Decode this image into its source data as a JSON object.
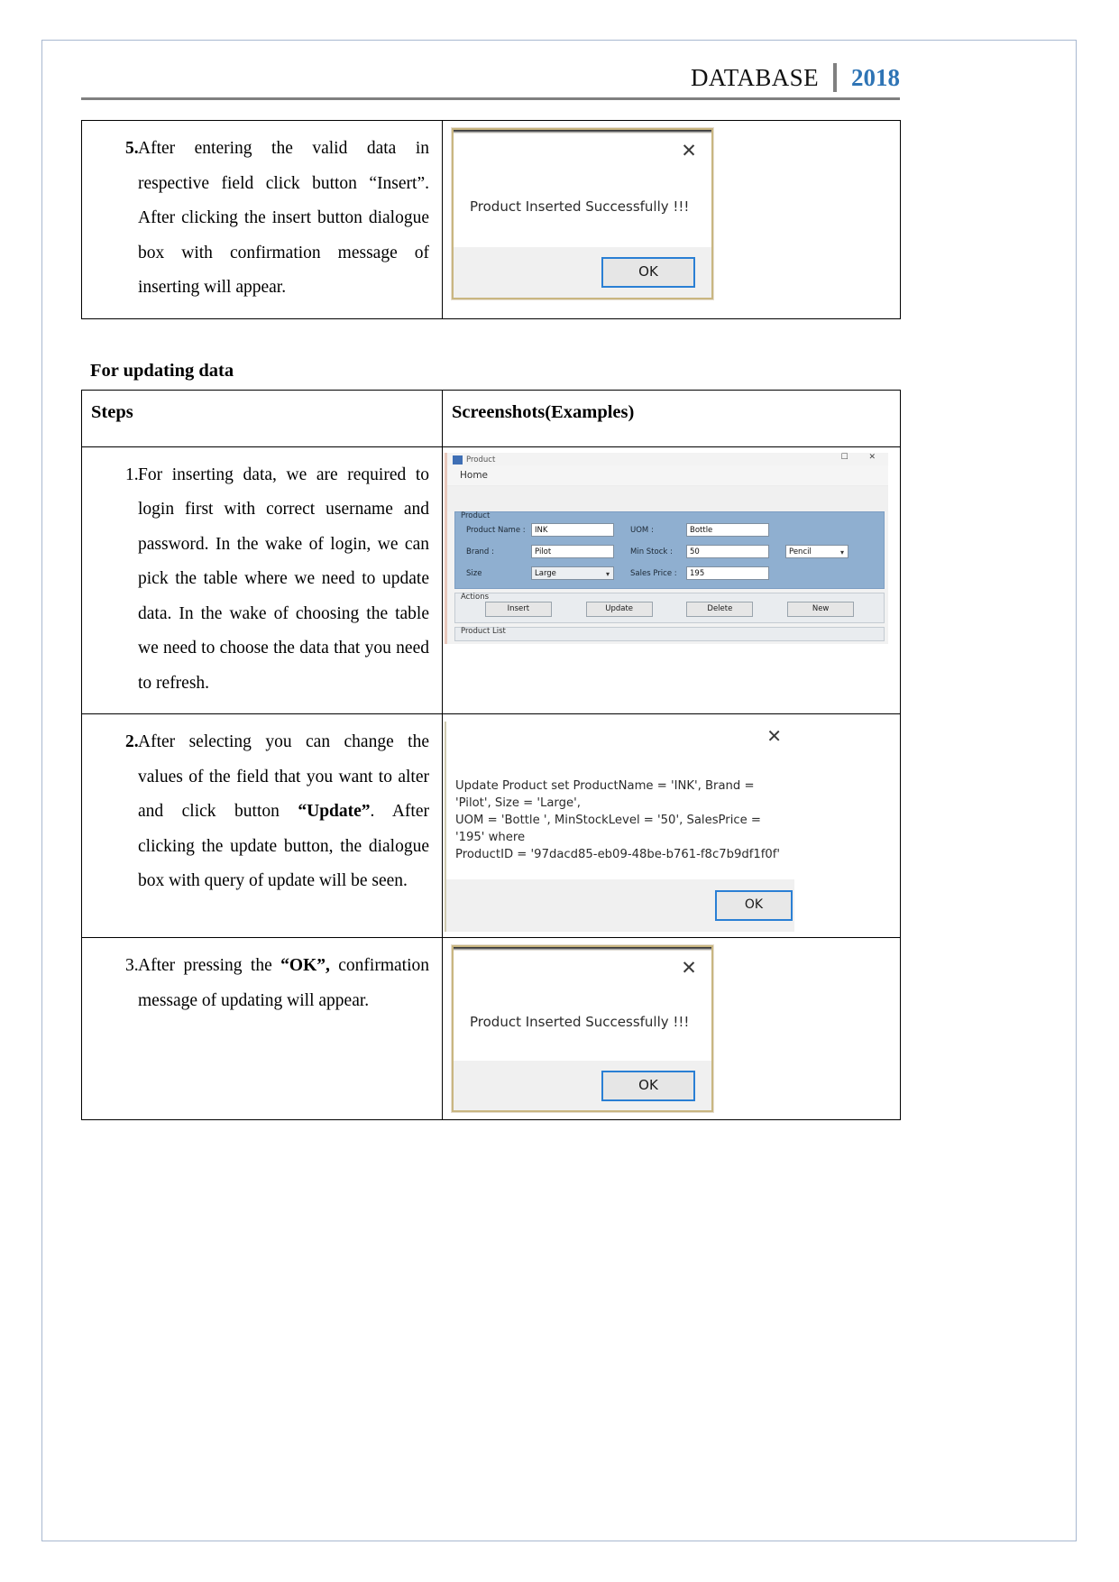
{
  "header": {
    "title": "DATABASE",
    "year": "2018"
  },
  "insert_table": {
    "row": {
      "number": "5.",
      "text": "After entering the valid data in respective field click button “Insert”. After clicking the insert button dialogue box with confirmation message of inserting will appear."
    },
    "dialog": {
      "close_icon": "✕",
      "message": "Product Inserted Successfully !!!",
      "ok_label": "OK"
    }
  },
  "section": {
    "heading": "For updating data"
  },
  "update_table": {
    "headers": {
      "steps": "Steps",
      "screenshots": "Screenshots(Examples)"
    },
    "rows": [
      {
        "number": "1.",
        "bold_number": false,
        "text": "For inserting data, we are required to login first with correct username and password. In the wake of login, we can pick the table where we need to update data. In the wake of choosing the table we need to choose the data that you need to refresh."
      },
      {
        "number": "2.",
        "bold_number": true,
        "text_part1": "After selecting you can change the values of the field that you want to alter and click button ",
        "text_bold": "“Update”",
        "text_part2": ". After clicking the update button, the dialogue box with query of update will be seen."
      },
      {
        "number": "3.",
        "bold_number": false,
        "text_part1": "After pressing the ",
        "text_bold": "“OK”,",
        "text_part2": " confirmation message of updating will appear."
      }
    ]
  },
  "product_app": {
    "window_title": "Product",
    "window_controls": "☐ ✕",
    "menu": "Home",
    "product_group": {
      "legend": "Product",
      "fields": [
        {
          "label": "Product Name :",
          "value": "INK"
        },
        {
          "label": "UOM :",
          "value": "Bottle"
        },
        {
          "label": "Brand :",
          "value": "Pilot"
        },
        {
          "label": "Min Stock :",
          "value": "50"
        },
        {
          "label": "Size",
          "value": "Large"
        },
        {
          "label": "Sales Price :",
          "value": "195"
        }
      ],
      "category_dropdown": "Pencil"
    },
    "actions_group": {
      "legend": "Actions",
      "buttons": [
        "Insert",
        "Update",
        "Delete",
        "New"
      ]
    },
    "list_group": {
      "legend": "Product List"
    }
  },
  "update_dialog": {
    "close_icon": "✕",
    "sql_text": "Update Product set ProductName =  'INK', Brand = 'Pilot', Size = 'Large',\nUOM = 'Bottle    ', MinStockLevel = '50', SalesPrice = '195' where\nProductID = '97dacd85-eb09-48be-b761-f8c7b9df1f0f'",
    "ok_label": "OK"
  },
  "confirm_dialog": {
    "close_icon": "✕",
    "message": "Product Inserted Successfully !!!",
    "ok_label": "OK"
  }
}
